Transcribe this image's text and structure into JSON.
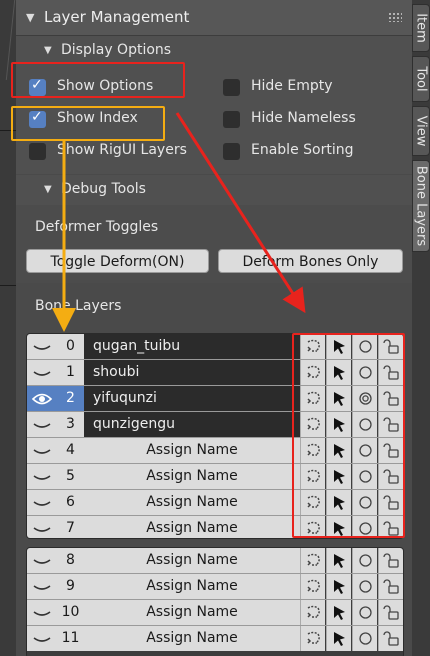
{
  "panel": {
    "title": "Layer Management",
    "display_options": "Display Options",
    "options": [
      {
        "label": "Show Options",
        "checked": true
      },
      {
        "label": "Hide Empty",
        "checked": false
      },
      {
        "label": "Show Index",
        "checked": true
      },
      {
        "label": "Hide Nameless",
        "checked": false
      },
      {
        "label": "Show RigUI Layers",
        "checked": false
      },
      {
        "label": "Enable Sorting",
        "checked": false
      }
    ],
    "debug_tools": "Debug Tools",
    "deformer_toggles": "Deformer Toggles",
    "toggle_deform_label": "Toggle Deform(ON)",
    "deform_bones_only_label": "Deform Bones Only",
    "bone_layers_label": "Bone Layers"
  },
  "layers_group1": [
    {
      "index": "0",
      "name": "qugan_tuibu",
      "named": true,
      "visible": false
    },
    {
      "index": "1",
      "name": "shoubi",
      "named": true,
      "visible": false
    },
    {
      "index": "2",
      "name": "yifuqunzi",
      "named": true,
      "visible": true
    },
    {
      "index": "3",
      "name": "qunzigengu",
      "named": true,
      "visible": false
    },
    {
      "index": "4",
      "name": "Assign Name",
      "named": false,
      "visible": false
    },
    {
      "index": "5",
      "name": "Assign Name",
      "named": false,
      "visible": false
    },
    {
      "index": "6",
      "name": "Assign Name",
      "named": false,
      "visible": false
    },
    {
      "index": "7",
      "name": "Assign Name",
      "named": false,
      "visible": false
    }
  ],
  "layers_group2": [
    {
      "index": "8",
      "name": "Assign Name",
      "named": false,
      "visible": false
    },
    {
      "index": "9",
      "name": "Assign Name",
      "named": false,
      "visible": false
    },
    {
      "index": "10",
      "name": "Assign Name",
      "named": false,
      "visible": false
    },
    {
      "index": "11",
      "name": "Assign Name",
      "named": false,
      "visible": false
    }
  ],
  "tabs": [
    {
      "label": "Item",
      "active": false
    },
    {
      "label": "Tool",
      "active": false
    },
    {
      "label": "View",
      "active": false
    },
    {
      "label": "Bone Layers",
      "active": true
    }
  ],
  "colors": {
    "accent": "#5680c2",
    "annotation_red": "#e8231d",
    "annotation_orange": "#f4ad12"
  }
}
